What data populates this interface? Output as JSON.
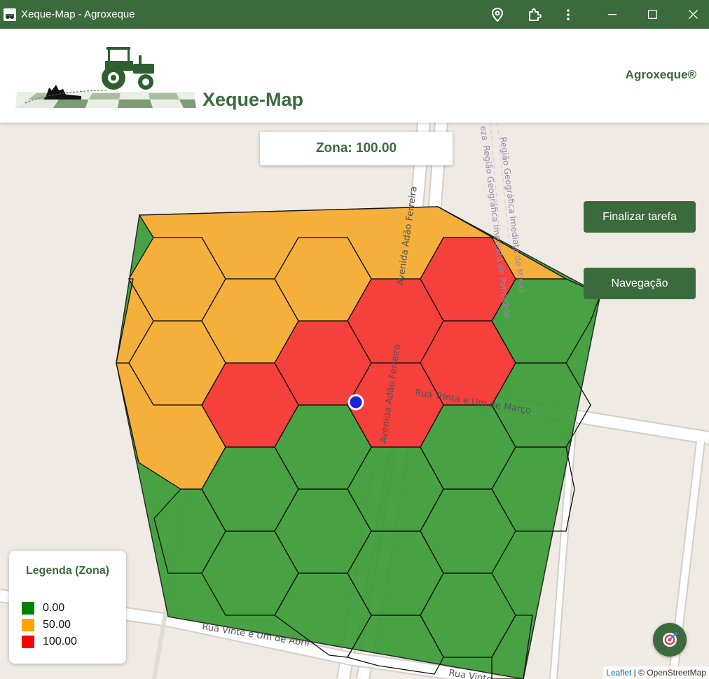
{
  "window": {
    "title": "Xeque-Map - Agroxeque"
  },
  "header": {
    "app_name": "Xeque-Map",
    "company": "Agroxeque®"
  },
  "zona_display": "Zona: 100.00",
  "buttons": {
    "finish_task": "Finalizar tarefa",
    "navigation": "Navegação"
  },
  "legend": {
    "title": "Legenda (Zona)",
    "items": [
      {
        "label": "0.00",
        "color": "#008000"
      },
      {
        "label": "50.00",
        "color": "#ffa500"
      },
      {
        "label": "100.00",
        "color": "#ff0000"
      }
    ]
  },
  "map": {
    "street_labels": [
      "Avenida Adão Ferreira",
      "Avenida Adão Ferreira",
      "Rua Trinta e Um de Março",
      "Rua Vinte e Um de Abril",
      "Rua Vinte",
      "Região Geográfica Imediata de Patrocínio",
      "Região Geográfica Imediata de Minas",
      "eza"
    ],
    "zone_colors": {
      "green": "#3a9a35",
      "orange": "#ffb03b",
      "red": "#ff3b3b"
    }
  },
  "attribution": {
    "link": "Leaflet",
    "separator": " | ",
    "text": "© OpenStreetMap"
  }
}
